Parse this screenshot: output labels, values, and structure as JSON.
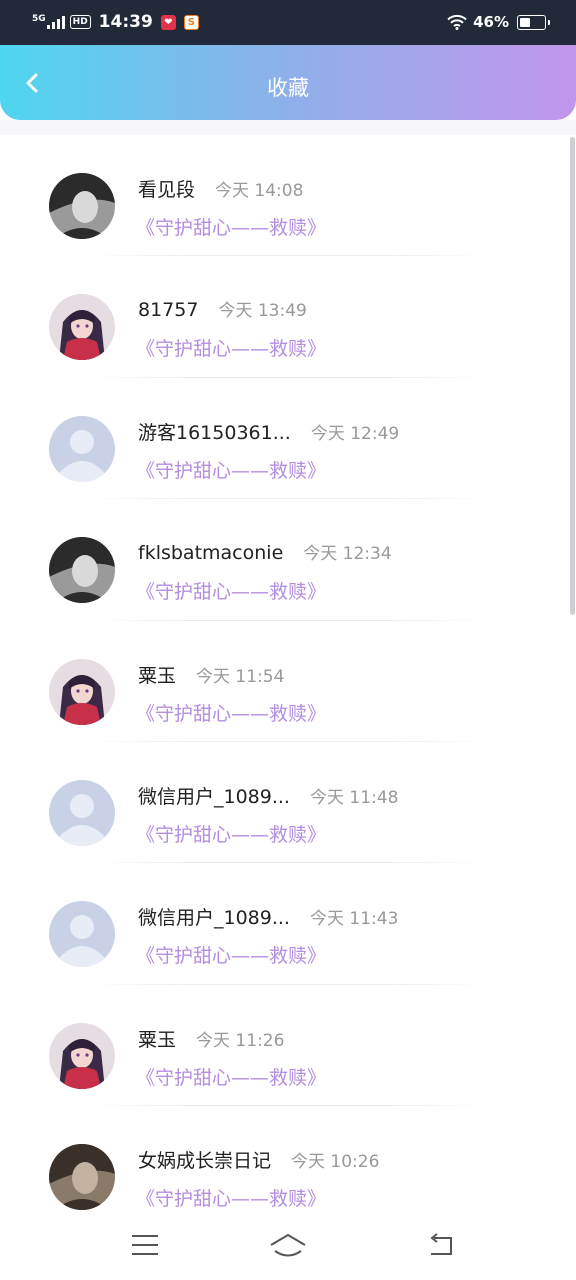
{
  "status_bar": {
    "network": "5G",
    "hd": "HD",
    "time": "14:39",
    "battery_text": "46%",
    "battery_level": 0.46,
    "icons": [
      "signal-icon",
      "hd-icon",
      "red-app-icon",
      "orange-app-icon",
      "wifi-icon",
      "battery-icon"
    ]
  },
  "header": {
    "title": "收藏",
    "back_icon": "chevron-left-icon"
  },
  "items": [
    {
      "name": "看见段",
      "time": "今天 14:08",
      "work": "《守护甜心——救赎》",
      "avatar": "photo"
    },
    {
      "name": "81757",
      "time": "今天 13:49",
      "work": "《守护甜心——救赎》",
      "avatar": "anime"
    },
    {
      "name": "游客16150361...",
      "time": "今天 12:49",
      "work": "《守护甜心——救赎》",
      "avatar": "default"
    },
    {
      "name": "fklsbatmaconie",
      "time": "今天 12:34",
      "work": "《守护甜心——救赎》",
      "avatar": "photo"
    },
    {
      "name": "粟玉",
      "time": "今天 11:54",
      "work": "《守护甜心——救赎》",
      "avatar": "anime"
    },
    {
      "name": "微信用户_1089...",
      "time": "今天 11:48",
      "work": "《守护甜心——救赎》",
      "avatar": "default"
    },
    {
      "name": "微信用户_1089...",
      "time": "今天 11:43",
      "work": "《守护甜心——救赎》",
      "avatar": "default"
    },
    {
      "name": "粟玉",
      "time": "今天 11:26",
      "work": "《守护甜心——救赎》",
      "avatar": "anime"
    },
    {
      "name": "女娲成长崇日记",
      "time": "今天 10:26",
      "work": "《守护甜心——救赎》",
      "avatar": "photo"
    }
  ],
  "nav": {
    "icons": [
      "menu-icon",
      "home-icon",
      "back-arrow-icon"
    ]
  },
  "colors": {
    "header_gradient": [
      "#4fd6f0",
      "#8fb0ea",
      "#c296ec"
    ],
    "work_title": "#b48ee0",
    "time_text": "#999999",
    "name_text": "#222222"
  }
}
